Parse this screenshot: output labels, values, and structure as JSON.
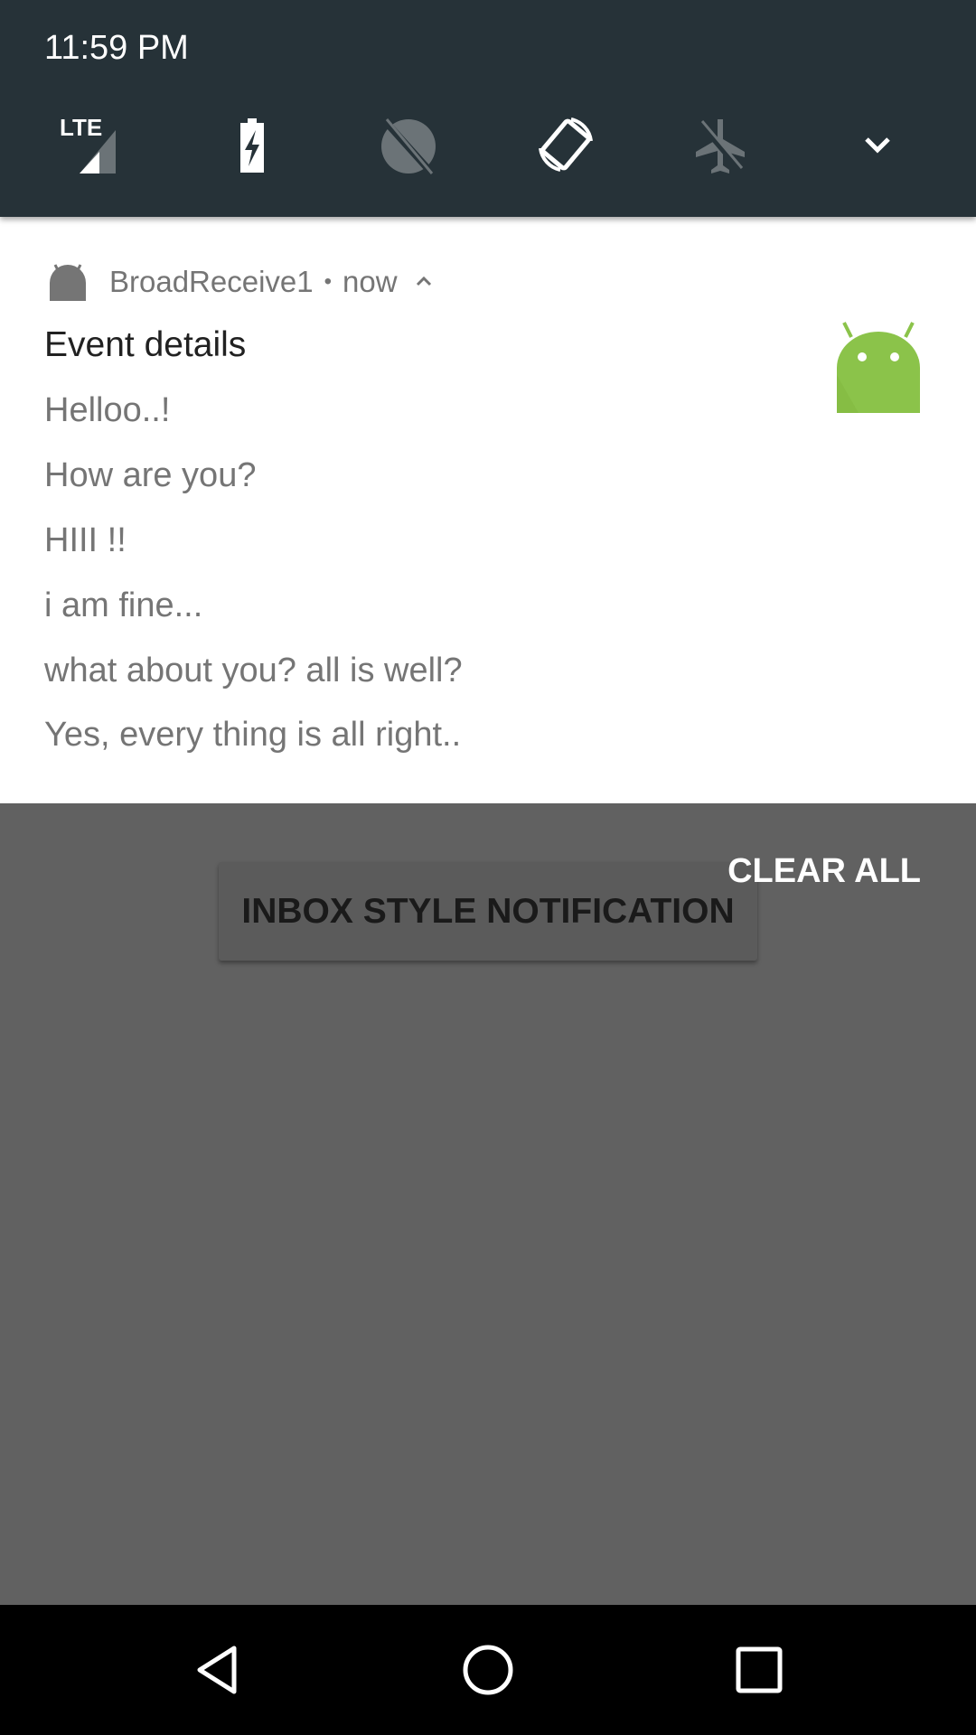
{
  "status_bar": {
    "time": "11:59 PM"
  },
  "quick_settings": {
    "tiles": [
      {
        "icon": "lte-signal-icon",
        "label": "LTE"
      },
      {
        "icon": "battery-charging-icon"
      },
      {
        "icon": "data-saver-off-icon"
      },
      {
        "icon": "auto-rotate-icon"
      },
      {
        "icon": "airplane-mode-off-icon"
      },
      {
        "icon": "chevron-down-icon"
      }
    ]
  },
  "notification": {
    "app_name": "BroadReceive1",
    "separator": "•",
    "time": "now",
    "title": "Event details",
    "lines": [
      "Helloo..!",
      "How are you?",
      "HIII !!",
      "i am fine...",
      "what about you? all is well?",
      "Yes, every thing is all right.."
    ],
    "accent": "#8BC34A"
  },
  "clear_all": "CLEAR ALL",
  "app": {
    "button_label": "INBOX STYLE NOTIFICATION"
  },
  "nav": {
    "back": "back-icon",
    "home": "home-icon",
    "recents": "recents-icon"
  }
}
